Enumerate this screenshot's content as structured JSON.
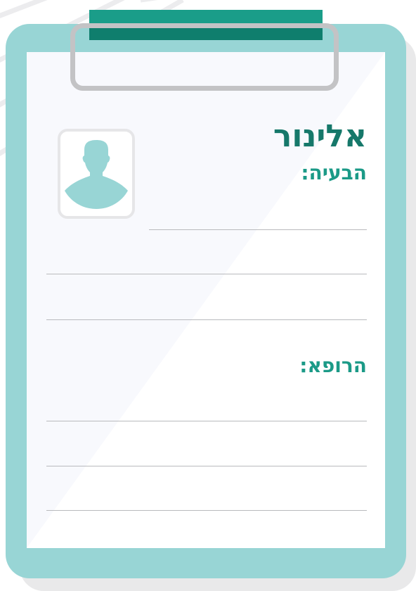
{
  "form": {
    "patient_name": "אלינור",
    "problem_label": "הבעיה:",
    "doctor_label": "הרופא:"
  },
  "icons": {
    "avatar": "person-silhouette-icon"
  },
  "colors": {
    "board": "#98d5d5",
    "clip": "#1a9d89",
    "clip_dark": "#0f7e6d",
    "clip_ring": "#c3c3c5",
    "title": "#16786a",
    "label": "#1b9a87",
    "paper": "#f8f9fd",
    "line": "#b9babd"
  }
}
